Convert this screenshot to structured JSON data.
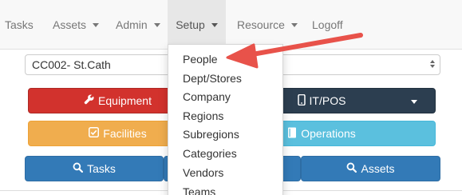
{
  "navbar": {
    "items": [
      {
        "label": "Tasks",
        "has_caret": false
      },
      {
        "label": "Assets",
        "has_caret": true
      },
      {
        "label": "Admin",
        "has_caret": true
      },
      {
        "label": "Setup",
        "has_caret": true,
        "active": true
      },
      {
        "label": "Resource",
        "has_caret": true
      },
      {
        "label": "Logoff",
        "has_caret": false
      }
    ]
  },
  "site_select": {
    "value": "CC002- St.Cath"
  },
  "buttons": {
    "equipment": {
      "label": "Equipment",
      "icon": "wrench-icon",
      "color": "#d2322d"
    },
    "itpos": {
      "label": "IT/POS",
      "icon": "mobile-icon",
      "color": "#2c3e50"
    },
    "facilities": {
      "label": "Facilities",
      "icon": "check-square-icon",
      "color": "#f0ad4e"
    },
    "operations": {
      "label": "Operations",
      "icon": "book-icon",
      "color": "#5bc0de"
    },
    "tasks": {
      "label": "Tasks",
      "icon": "search-icon",
      "color": "#337ab7"
    },
    "assets": {
      "label": "Assets",
      "icon": "search-icon",
      "color": "#337ab7"
    }
  },
  "setup_menu": {
    "items": [
      "People",
      "Dept/Stores",
      "Company",
      "Regions",
      "Subregions",
      "Categories",
      "Vendors",
      "Teams"
    ]
  },
  "annotation": {
    "color": "#e8524a",
    "points_to": "People"
  }
}
